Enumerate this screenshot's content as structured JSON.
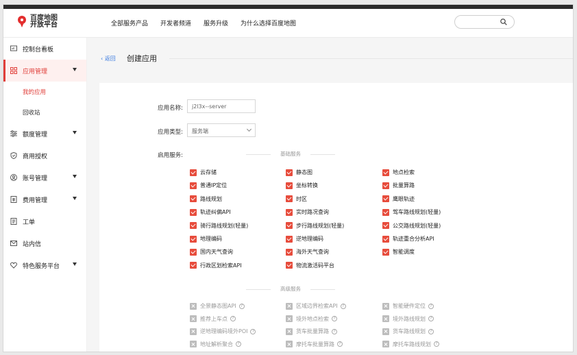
{
  "header": {
    "logo_line1": "百度地图",
    "logo_line2": "开放平台",
    "nav": [
      "全部服务产品",
      "开发者频道",
      "服务升级",
      "为什么选择百度地图"
    ],
    "search_placeholder": ""
  },
  "sidebar": {
    "items": [
      {
        "label": "控制台看板",
        "icon": "dashboard-icon"
      },
      {
        "label": "应用管理",
        "icon": "apps-icon",
        "expanded": true,
        "active": true
      },
      {
        "label": "额度管理",
        "icon": "quota-icon"
      },
      {
        "label": "商用授权",
        "icon": "shield-icon"
      },
      {
        "label": "账号管理",
        "icon": "account-icon"
      },
      {
        "label": "费用管理",
        "icon": "fee-icon"
      },
      {
        "label": "工单",
        "icon": "ticket-icon"
      },
      {
        "label": "站内信",
        "icon": "mail-icon"
      },
      {
        "label": "特色服务平台",
        "icon": "heart-icon"
      }
    ],
    "sub_items": [
      {
        "label": "我的应用",
        "active": true
      },
      {
        "label": "回收站"
      }
    ]
  },
  "main": {
    "back_label": "返回",
    "title": "创建应用",
    "form": {
      "app_name_label": "应用名称:",
      "app_name_value": "j2l3x--server",
      "app_type_label": "应用类型:",
      "app_type_value": "服务端",
      "services_label": "启用服务:"
    },
    "basic_section": "基础服务",
    "advanced_section": "高级服务",
    "basic_services": [
      [
        "云存储",
        "静态图",
        "地点检索"
      ],
      [
        "普通IP定位",
        "坐标转换",
        "批量算路"
      ],
      [
        "路线规划",
        "时区",
        "鹰眼轨迹"
      ],
      [
        "轨迹纠偏API",
        "实时路况查询",
        "驾车路线规划(轻量)"
      ],
      [
        "骑行路线规划(轻量)",
        "步行路线规划(轻量)",
        "公交路线规划(轻量)"
      ],
      [
        "地理编码",
        "逆地理编码",
        "轨迹重合分析API"
      ],
      [
        "国内天气查询",
        "海外天气查询",
        "智能调度"
      ],
      [
        "行政区划检索API",
        "物流激活码平台",
        ""
      ]
    ],
    "advanced_services": [
      [
        "全景静态图API",
        "区域边界检索API",
        "智能硬件定位"
      ],
      [
        "推荐上车点",
        "境外地点检索",
        "境外路线规划"
      ],
      [
        "逆地理编码境外POI",
        "货车批量算路",
        "货车路线规划"
      ],
      [
        "地址解析聚合",
        "摩托车批量算路",
        "摩托车路线规划"
      ]
    ]
  },
  "colors": {
    "accent": "#e74c3c",
    "link": "#3b7be0"
  }
}
